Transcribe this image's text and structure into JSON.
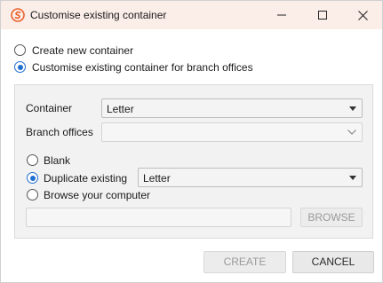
{
  "window": {
    "title": "Customise existing container"
  },
  "mode_options": {
    "create_new": "Create new container",
    "customise_branch": "Customise existing container for branch offices",
    "selected": "customise_branch"
  },
  "form": {
    "container_label": "Container",
    "container_value": "Letter",
    "branch_offices_label": "Branch offices",
    "branch_offices_value": ""
  },
  "source_options": {
    "blank": "Blank",
    "duplicate": "Duplicate existing",
    "duplicate_value": "Letter",
    "browse": "Browse your computer",
    "selected": "duplicate",
    "path_value": "",
    "browse_button": "BROWSE"
  },
  "footer": {
    "create_button": "CREATE",
    "cancel_button": "CANCEL"
  },
  "colors": {
    "titlebar_bg": "#fbeee8",
    "accent": "#1f6fd1",
    "logo": "#e8622c"
  }
}
